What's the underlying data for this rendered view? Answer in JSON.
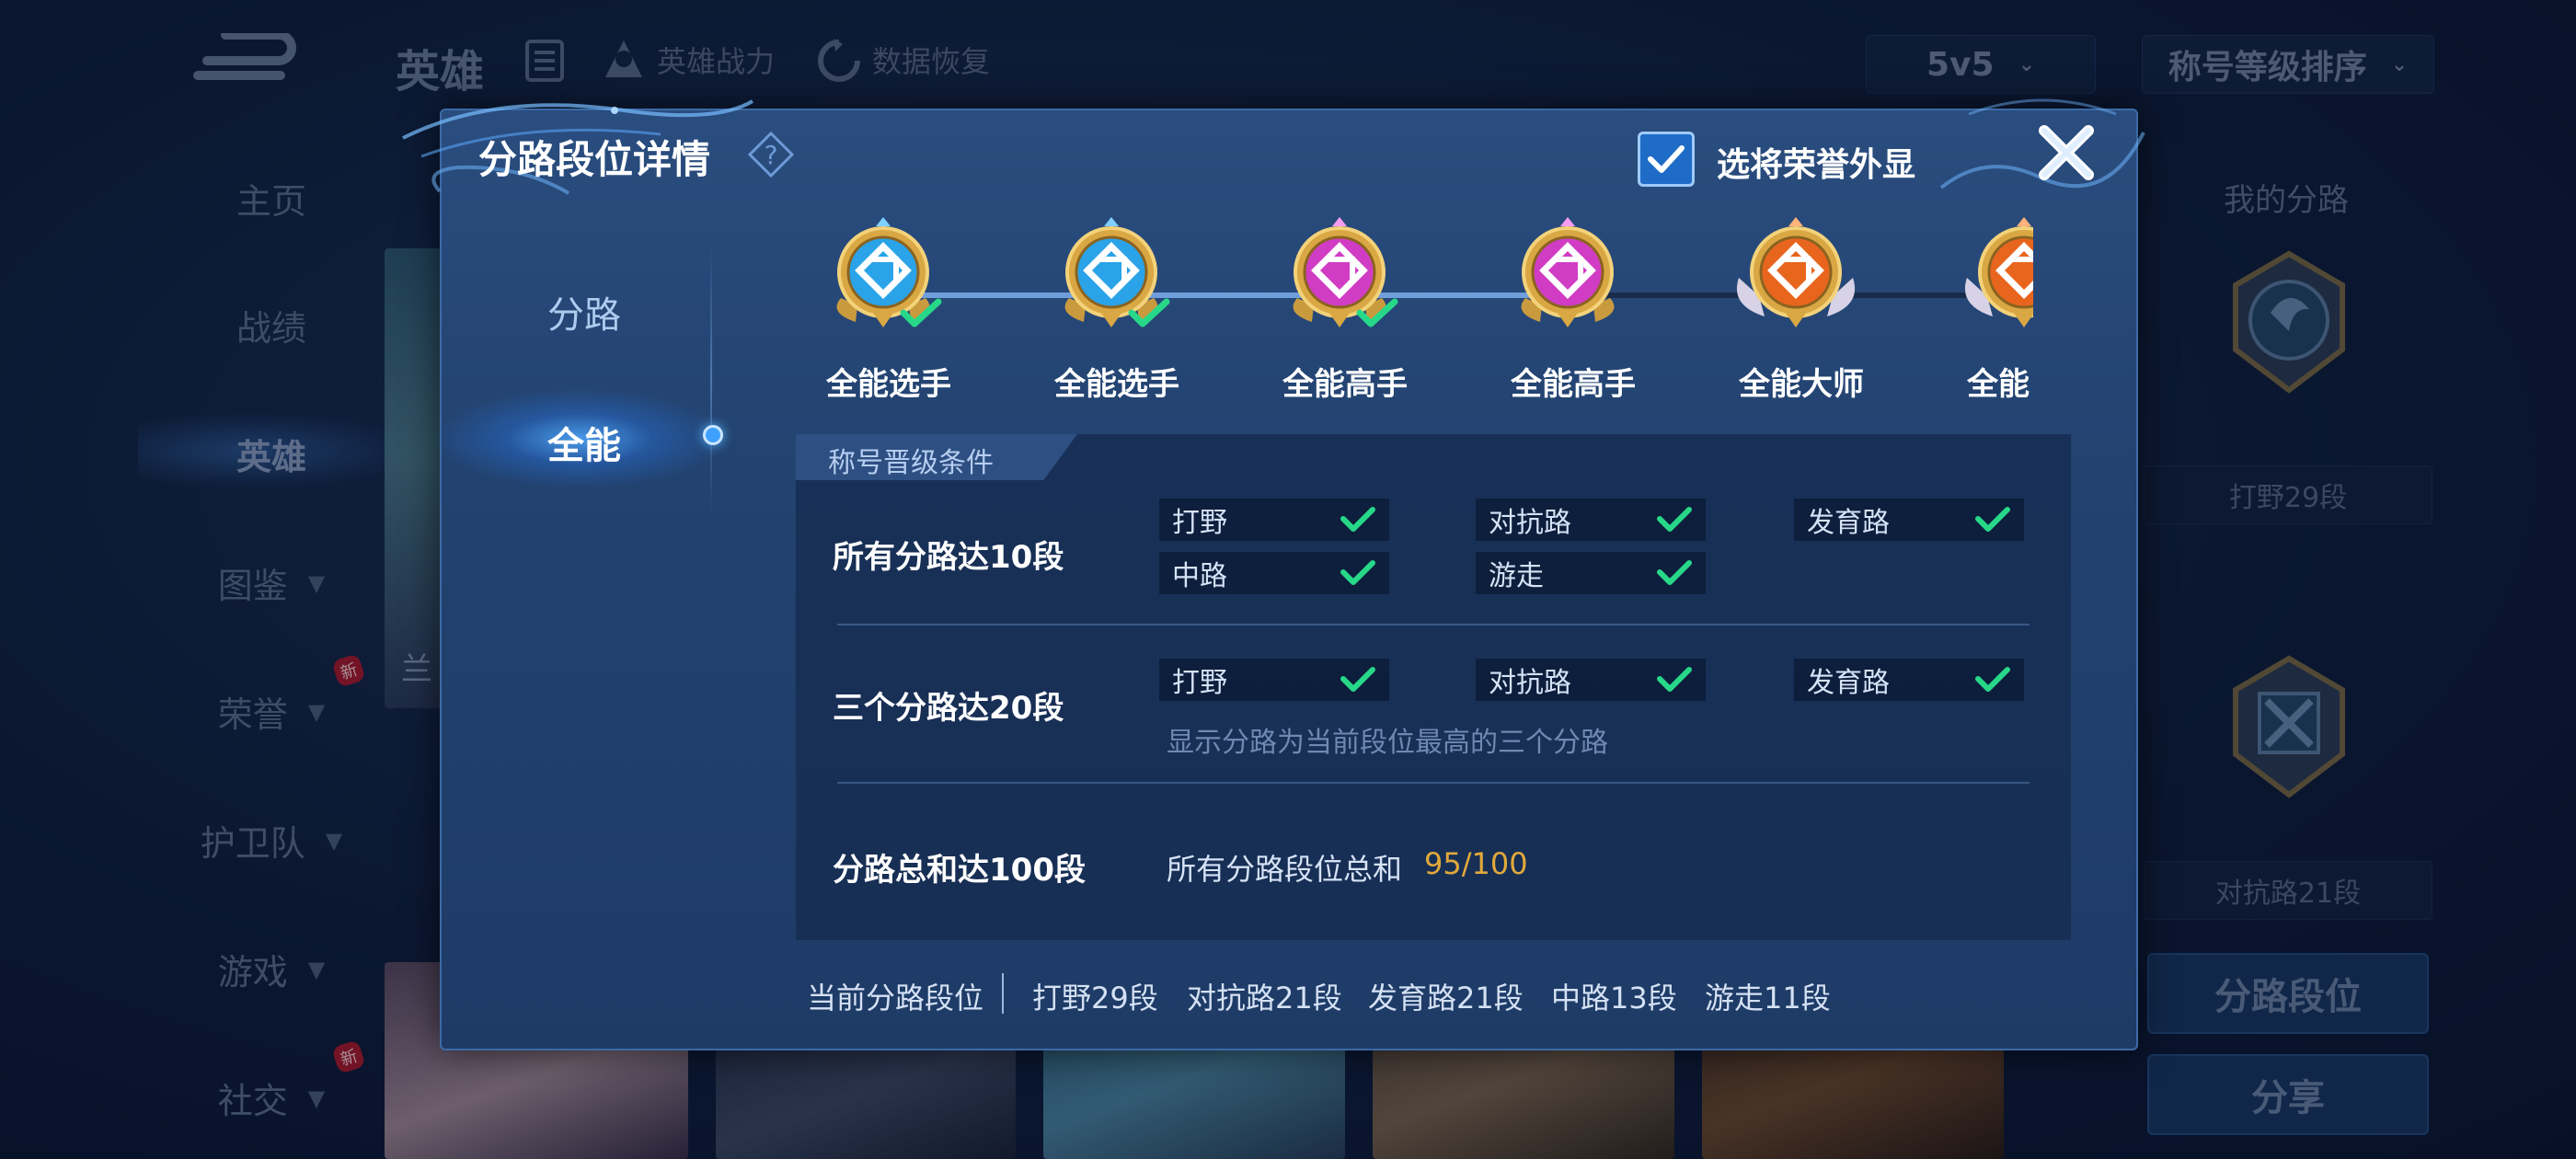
{
  "background": {
    "title": "英雄",
    "links": [
      {
        "label": "英雄战力",
        "icon": "warrior-icon"
      },
      {
        "label": "数据恢复",
        "icon": "restore-icon"
      }
    ],
    "mode_select": "5v5",
    "sort_select": "称号等级排序",
    "sidebar": [
      {
        "label": "主页"
      },
      {
        "label": "战绩"
      },
      {
        "label": "英雄",
        "active": true
      },
      {
        "label": "图鉴"
      },
      {
        "label": "荣誉",
        "badge": "新"
      },
      {
        "label": "护卫队"
      },
      {
        "label": "游戏"
      },
      {
        "label": "社交",
        "badge": "新"
      }
    ],
    "card_partial_text": "兰",
    "right_panel": {
      "title": "我的分路",
      "item1": "打野29段",
      "item2": "对抗路21段",
      "btn_route": "分路段位",
      "btn_share": "分享"
    }
  },
  "modal": {
    "title": "分路段位详情",
    "checkbox_label": "选将荣誉外显",
    "checkbox_checked": true,
    "tabs": [
      {
        "label": "分路",
        "active": false
      },
      {
        "label": "全能",
        "active": true
      }
    ],
    "ranks": [
      {
        "label": "全能选手",
        "tier": "blue",
        "achieved": true
      },
      {
        "label": "全能选手",
        "tier": "blue",
        "achieved": true
      },
      {
        "label": "全能高手",
        "tier": "purple",
        "achieved": true
      },
      {
        "label": "全能高手",
        "tier": "purple",
        "achieved": false
      },
      {
        "label": "全能大师",
        "tier": "orange",
        "achieved": false
      },
      {
        "label": "全能",
        "tier": "orange",
        "achieved": false
      }
    ],
    "panel_title": "称号晋级条件",
    "conditions": [
      {
        "label": "所有分路达10段",
        "routes": [
          "打野",
          "对抗路",
          "发育路",
          "中路",
          "游走"
        ]
      },
      {
        "label": "三个分路达20段",
        "routes": [
          "打野",
          "对抗路",
          "发育路"
        ],
        "note": "显示分路为当前段位最高的三个分路"
      },
      {
        "label": "分路总和达100段",
        "desc": "所有分路段位总和",
        "value": "95/100"
      }
    ],
    "footer": {
      "label": "当前分路段位",
      "items": [
        "打野29段",
        "对抗路21段",
        "发育路21段",
        "中路13段",
        "游走11段"
      ]
    },
    "colors": {
      "accent": "#1f6cc7",
      "check_green": "#27d889",
      "progress_value": "#e1a93b",
      "blue_tier": "#2aa3e8",
      "purple_tier": "#d13cc4",
      "orange_tier": "#e8651e"
    }
  }
}
